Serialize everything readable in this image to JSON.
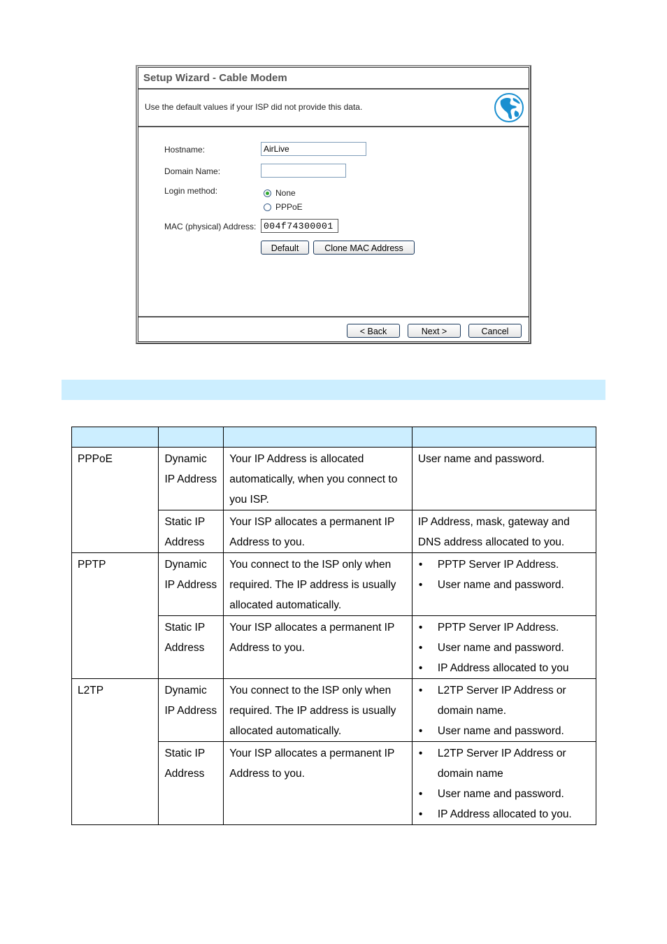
{
  "wizard": {
    "title": "Setup Wizard - Cable Modem",
    "description": "Use the default values if your ISP did not provide this data.",
    "icon": "globe-icon",
    "fields": {
      "hostname_label": "Hostname:",
      "hostname_value": "AirLive",
      "domain_label": "Domain Name:",
      "domain_value": "",
      "login_label": "Login method:",
      "login_options": [
        {
          "label": "None",
          "selected": true
        },
        {
          "label": "PPPoE",
          "selected": false
        }
      ],
      "mac_label": "MAC (physical) Address:",
      "mac_value": "004f74300001"
    },
    "buttons": {
      "default": "Default",
      "clone_mac": "Clone MAC Address",
      "back": "< Back",
      "next": "Next >",
      "cancel": "Cancel"
    }
  },
  "band": {
    "color": "#cceeff"
  },
  "table": {
    "header": [
      "",
      "",
      "",
      ""
    ],
    "groups": [
      {
        "type": "PPPoE",
        "rows": [
          {
            "ip": "Dynamic IP Address",
            "description": "Your IP Address is allocated automatically, when you connect to you ISP.",
            "requirements": [
              "User name and password."
            ],
            "bulleted": false
          },
          {
            "ip": "Static IP Address",
            "description": "Your ISP allocates a permanent IP Address to you.",
            "requirements": [
              "IP Address, mask, gateway and DNS address allocated to you."
            ],
            "bulleted": false
          }
        ]
      },
      {
        "type": "PPTP",
        "rows": [
          {
            "ip": "Dynamic IP Address",
            "description": "You connect to the ISP only when required. The IP address is usually allocated automatically.",
            "requirements": [
              "PPTP Server IP Address.",
              "User name and password."
            ],
            "bulleted": true
          },
          {
            "ip": "Static IP Address",
            "description": "Your ISP allocates a permanent IP Address to you.",
            "requirements": [
              "PPTP Server IP Address.",
              "User name and password.",
              "IP Address allocated to you"
            ],
            "bulleted": true
          }
        ]
      },
      {
        "type": "L2TP",
        "rows": [
          {
            "ip": "Dynamic IP Address",
            "description": "You connect to the ISP only when required. The IP address is usually allocated automatically.",
            "requirements": [
              "L2TP Server IP Address or domain name.",
              "User name and password."
            ],
            "bulleted": true
          },
          {
            "ip": "Static IP Address",
            "description": "Your ISP allocates a permanent IP Address to you.",
            "requirements": [
              "L2TP Server IP Address or domain name",
              "User name and password.",
              "IP Address allocated to you."
            ],
            "bulleted": true
          }
        ]
      }
    ]
  }
}
